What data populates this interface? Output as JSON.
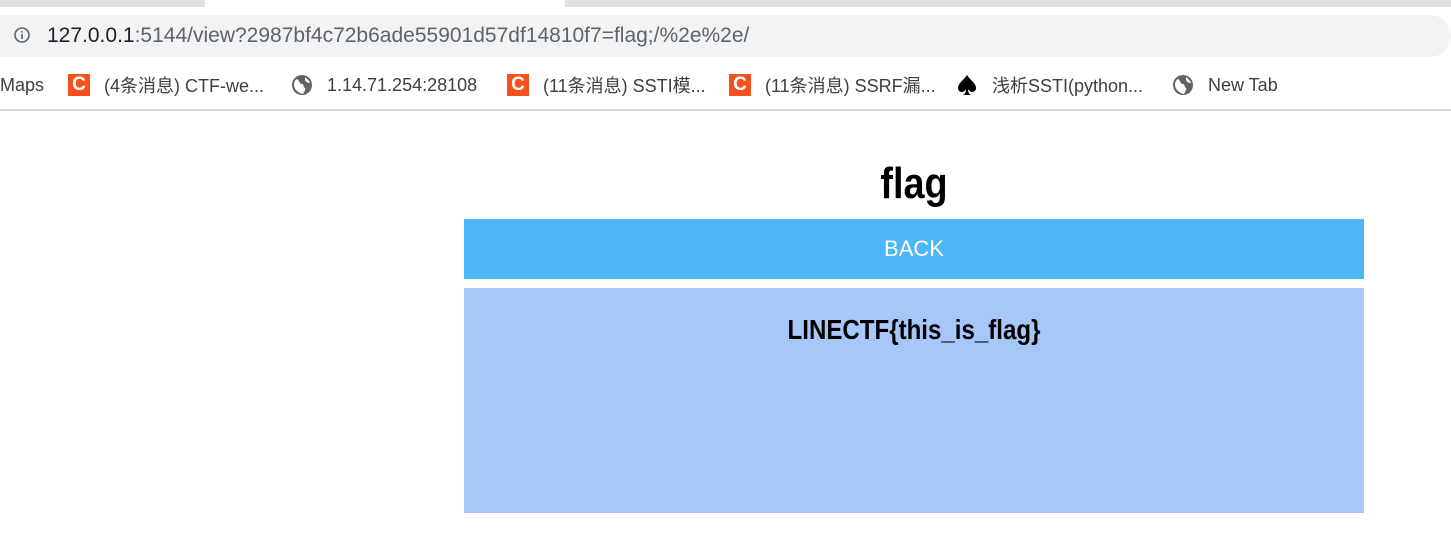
{
  "browser": {
    "address_bar": {
      "host": "127.0.0.1",
      "path": ":5144/view?2987bf4c72b6ade55901d57df14810f7=flag;/%2e%2e/",
      "info_icon": "info-circle-icon"
    },
    "bookmarks": [
      {
        "label": "Maps",
        "icon": "maps-icon"
      },
      {
        "label": "(4条消息) CTF-we...",
        "icon": "csdn-icon"
      },
      {
        "label": "1.14.71.254:28108",
        "icon": "globe-icon"
      },
      {
        "label": "(11条消息) SSTI模...",
        "icon": "csdn-icon"
      },
      {
        "label": "(11条消息) SSRF漏...",
        "icon": "csdn-icon"
      },
      {
        "label": "浅析SSTI(python...",
        "icon": "spade-icon"
      },
      {
        "label": "New Tab",
        "icon": "globe-icon"
      }
    ]
  },
  "page": {
    "title": "flag",
    "back_label": "BACK",
    "flag_content": "LINECTF{this_is_flag}",
    "colors": {
      "back_button": "#4db6f5",
      "content_box": "#a6c7f7"
    }
  }
}
